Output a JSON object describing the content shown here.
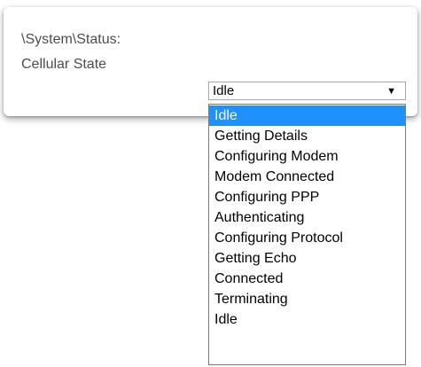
{
  "panel": {
    "path": "\\System\\Status:",
    "field_label": "Cellular State"
  },
  "select": {
    "value": "Idle",
    "arrow_icon": "triangle-down-icon",
    "options": [
      "Idle",
      "Getting Details",
      "Configuring Modem",
      "Modem Connected",
      "Configuring PPP",
      "Authenticating",
      "Configuring Protocol",
      "Getting Echo",
      "Connected",
      "Terminating",
      "Idle"
    ],
    "highlighted_index": 0
  },
  "colors": {
    "highlight": "#1e90ff",
    "label_text": "#4d4d4d"
  }
}
